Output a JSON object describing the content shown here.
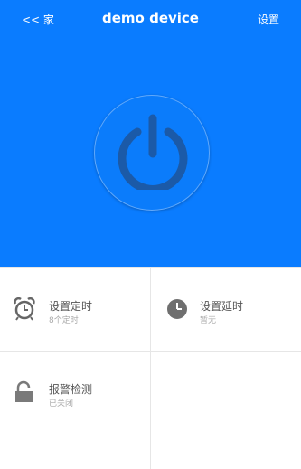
{
  "header": {
    "back_label": "<< 家",
    "title": "demo device",
    "settings_label": "设置",
    "background_color": "#0a7cff",
    "power_icon": "power-icon"
  },
  "grid": {
    "items": [
      {
        "label": "设置定时",
        "sub": "8个定时",
        "icon": "alarm-clock-icon"
      },
      {
        "label": "设置延时",
        "sub": "暂无",
        "icon": "clock-icon"
      },
      {
        "label": "报警检测",
        "sub": "已关闭",
        "icon": "unlocked-padlock-icon"
      }
    ]
  }
}
